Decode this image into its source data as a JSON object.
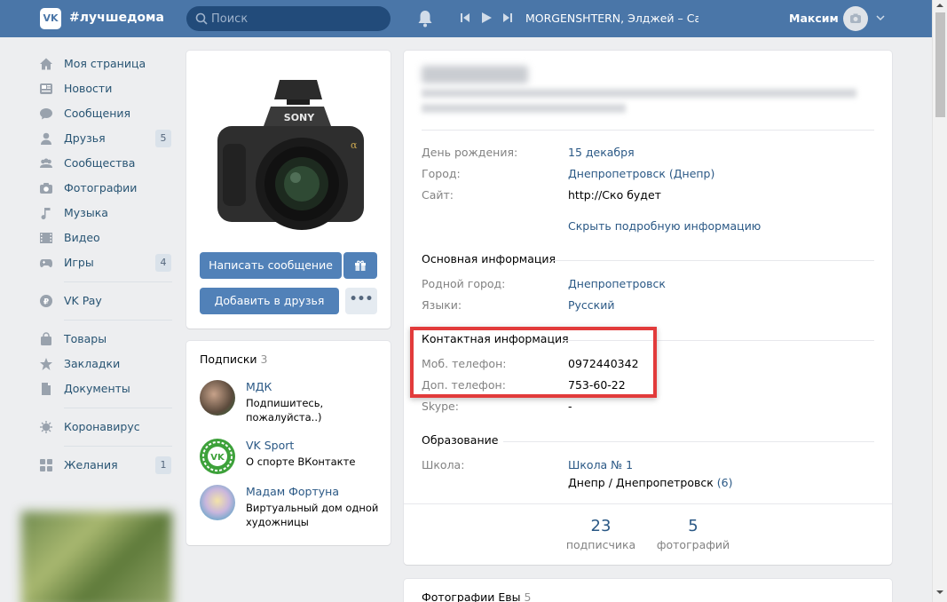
{
  "header": {
    "logo": "VK",
    "brand": "#лучшедома",
    "search_placeholder": "Поиск",
    "track": "MORGENSHTERN, Элджей – Cadill...",
    "user_name": "Максим"
  },
  "nav": {
    "items": [
      {
        "label": "Моя страница",
        "icon": "home-icon"
      },
      {
        "label": "Новости",
        "icon": "news-icon"
      },
      {
        "label": "Сообщения",
        "icon": "messages-icon"
      },
      {
        "label": "Друзья",
        "icon": "friends-icon",
        "badge": "5"
      },
      {
        "label": "Сообщества",
        "icon": "groups-icon"
      },
      {
        "label": "Фотографии",
        "icon": "camera-icon"
      },
      {
        "label": "Музыка",
        "icon": "music-icon"
      },
      {
        "label": "Видео",
        "icon": "video-icon"
      },
      {
        "label": "Игры",
        "icon": "games-icon",
        "badge": "4"
      }
    ],
    "pay": "VK Pay",
    "items2": [
      "Товары",
      "Закладки",
      "Документы"
    ],
    "covid": "Коронавирус",
    "wishes": "Желания",
    "wishes_badge": "1"
  },
  "profile_card": {
    "send_message": "Написать сообщение",
    "add_friend": "Добавить в друзья",
    "more": "•••"
  },
  "subscriptions": {
    "title": "Подписки",
    "count": "3",
    "items": [
      {
        "name": "МДК",
        "desc": "Подпишитесь, пожалуйста..)"
      },
      {
        "name": "VK Sport",
        "desc": "О спорте ВКонтакте"
      },
      {
        "name": "Мадам Фортуна",
        "desc": "Виртуальный дом одной художницы"
      }
    ]
  },
  "info": {
    "birthday_label": "День рождения:",
    "birthday": "15 декабря",
    "city_label": "Город:",
    "city": "Днепропетровск (Днепр)",
    "site_label": "Сайт:",
    "site": "http://Ско будет",
    "hide_details": "Скрыть подробную информацию",
    "main_section": "Основная информация",
    "hometown_label": "Родной город:",
    "hometown": "Днепропетровск",
    "languages_label": "Языки:",
    "languages": "Русский",
    "contact_section": "Контактная информация",
    "mobile_label": "Моб. телефон:",
    "mobile": "0972440342",
    "phone2_label": "Доп. телефон:",
    "phone2": "753-60-22",
    "skype_label": "Skype:",
    "skype": "-",
    "education_section": "Образование",
    "school_label": "Школа:",
    "school": "Школа № 1",
    "school_city": "Днепр / Днепропетровск",
    "school_years": "(6)",
    "followers_count": "23",
    "followers_label": "подписчика",
    "photos_count": "5",
    "photos_label": "фотографий"
  },
  "photos_block": {
    "title": "Фотографии Евы",
    "count": "5"
  }
}
